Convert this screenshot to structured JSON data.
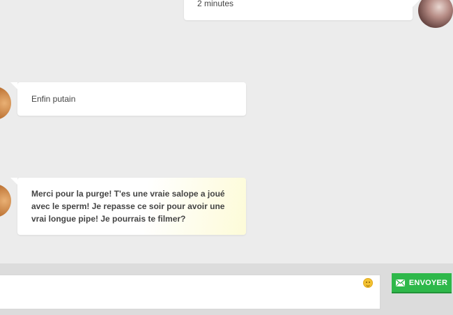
{
  "messages": [
    {
      "direction": "out",
      "text": "2 minutes"
    },
    {
      "direction": "in",
      "text": "Enfin putain"
    },
    {
      "direction": "in",
      "text": "Merci pour la purge! T'es une vraie salope a joué avec le sperm! Je repasse ce soir pour avoir une vrai longue pipe! Je pourrais te filmer?"
    }
  ],
  "composer": {
    "input_value": "",
    "input_placeholder": "",
    "send_label": "ENVOYER",
    "send_icon": "envelope-icon",
    "emoji_icon": "emoji-smiley-icon"
  },
  "colors": {
    "background": "#ececec",
    "composer_bar": "#dcdcdc",
    "send_button": "#2eb84a",
    "highlight_bubble": "#fdfbd8"
  }
}
